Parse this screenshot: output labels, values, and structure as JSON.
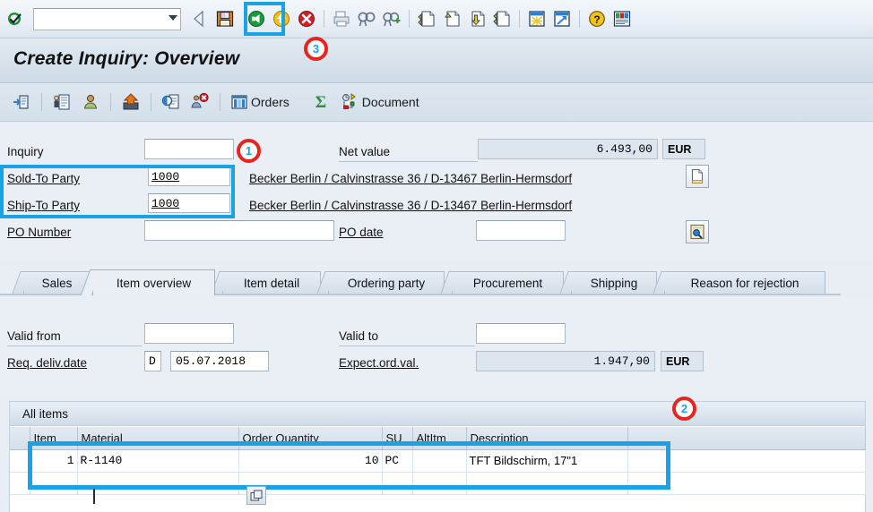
{
  "toolbar_top": {
    "command_value": "",
    "command_placeholder": "",
    "icons": [
      {
        "name": "enter-ok-icon",
        "glyph": "ok"
      },
      {
        "name": "back-prev-icon",
        "glyph": "prev"
      },
      {
        "name": "save-icon",
        "glyph": "save"
      },
      {
        "name": "back-green-icon",
        "glyph": "back"
      },
      {
        "name": "exit-yellow-icon",
        "glyph": "exit"
      },
      {
        "name": "cancel-red-icon",
        "glyph": "cancel"
      },
      {
        "name": "print-icon",
        "glyph": "print"
      },
      {
        "name": "find-icon",
        "glyph": "find"
      },
      {
        "name": "find-next-icon",
        "glyph": "findnext"
      },
      {
        "name": "first-page-icon",
        "glyph": "first"
      },
      {
        "name": "previous-page-icon",
        "glyph": "up"
      },
      {
        "name": "next-page-icon",
        "glyph": "down"
      },
      {
        "name": "last-page-icon",
        "glyph": "last"
      },
      {
        "name": "create-session-icon",
        "glyph": "session"
      },
      {
        "name": "create-shortcut-icon",
        "glyph": "shortcut"
      },
      {
        "name": "help-icon",
        "glyph": "help"
      },
      {
        "name": "customize-layout-icon",
        "glyph": "layout"
      }
    ]
  },
  "title": "Create Inquiry: Overview",
  "toolbar_app": {
    "buttons": [
      {
        "name": "display-doc-header-icon",
        "label": ""
      },
      {
        "name": "item-details-icon",
        "label": ""
      },
      {
        "name": "partner-icon",
        "label": ""
      },
      {
        "name": "availability-icon",
        "label": ""
      },
      {
        "name": "pricing-conditions-icon",
        "label": ""
      },
      {
        "name": "reject-item-icon",
        "label": ""
      },
      {
        "name": "orders-button",
        "label": "Orders"
      },
      {
        "name": "sum-icon",
        "label": ""
      },
      {
        "name": "document-button",
        "label": "Document"
      }
    ],
    "orders_label": "Orders",
    "document_label": "Document"
  },
  "header_form": {
    "inquiry_label": "Inquiry",
    "inquiry_value": "",
    "sold_to_label": "Sold-To Party",
    "sold_to_value": "1000",
    "sold_to_address": "Becker Berlin / Calvinstrasse 36 / D-13467 Berlin-Hermsdorf",
    "ship_to_label": "Ship-To Party",
    "ship_to_value": "1000",
    "ship_to_address": "Becker Berlin / Calvinstrasse 36 / D-13467 Berlin-Hermsdorf",
    "po_number_label": "PO Number",
    "po_number_value": "",
    "net_value_label": "Net value",
    "net_value_amount": "6.493,00",
    "net_value_currency": "EUR",
    "po_date_label": "PO date",
    "po_date_value": "",
    "doc_button_name": "open-document-icon",
    "search_button_name": "address-search-icon"
  },
  "tabs": [
    {
      "label": "Sales",
      "active": false
    },
    {
      "label": "Item overview",
      "active": true
    },
    {
      "label": "Item detail",
      "active": false
    },
    {
      "label": "Ordering party",
      "active": false
    },
    {
      "label": "Procurement",
      "active": false
    },
    {
      "label": "Shipping",
      "active": false
    },
    {
      "label": "Reason for rejection",
      "active": false
    }
  ],
  "detail_form": {
    "valid_from_label": "Valid from",
    "valid_from_value": "",
    "valid_to_label": "Valid to",
    "valid_to_value": "",
    "req_deliv_label": "Req. deliv.date",
    "req_deliv_type": "D",
    "req_deliv_value": "05.07.2018",
    "expect_ord_label": "Expect.ord.val.",
    "expect_ord_amount": "1.947,90",
    "expect_ord_currency": "EUR"
  },
  "items": {
    "panel_title": "All items",
    "columns": [
      "Item",
      "Material",
      "Order Quantity",
      "SU",
      "AltItm",
      "Description"
    ],
    "rows": [
      {
        "item": "1",
        "material": "R-1140",
        "order_quantity": "10",
        "su": "PC",
        "altitm": "",
        "description": "TFT Bildschirm, 17\"1"
      }
    ],
    "new_row": {
      "item": "",
      "material": "",
      "order_quantity": "",
      "su": "",
      "altitm": "",
      "description": ""
    }
  },
  "callouts": [
    {
      "number": "1"
    },
    {
      "number": "2"
    },
    {
      "number": "3"
    }
  ],
  "colors": {
    "highlight": "#19a3e6",
    "callout_ring": "#e8241f",
    "callout_text": "#19a3e6",
    "selected_cell": "#fbe7a8",
    "page_bg": "#e9eef4"
  }
}
